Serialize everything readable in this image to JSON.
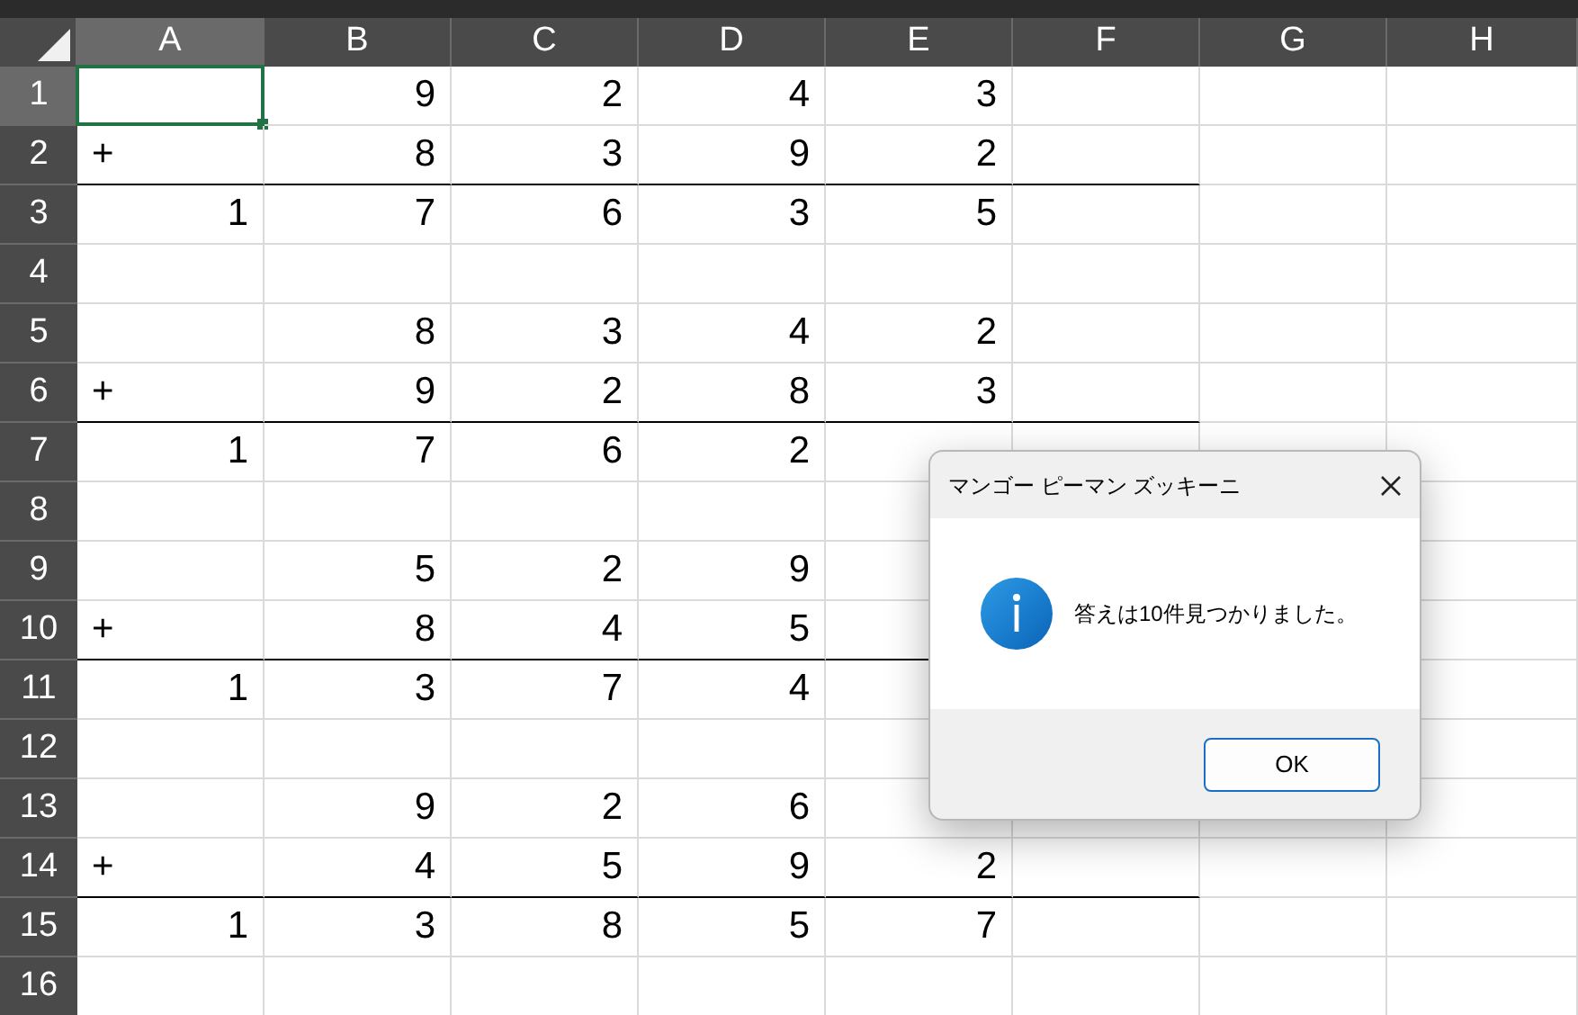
{
  "sheet": {
    "columns": [
      {
        "label": "A",
        "selected": true
      },
      {
        "label": "B",
        "selected": false
      },
      {
        "label": "C",
        "selected": false
      },
      {
        "label": "D",
        "selected": false
      },
      {
        "label": "E",
        "selected": false
      },
      {
        "label": "F",
        "selected": false
      },
      {
        "label": "G",
        "selected": false
      },
      {
        "label": "H",
        "selected": false
      }
    ],
    "rows": [
      {
        "header": "1",
        "selected": true,
        "underlined": false,
        "cells": [
          null,
          "9",
          "2",
          "4",
          "3"
        ]
      },
      {
        "header": "2",
        "selected": false,
        "underlined": true,
        "operator": "+",
        "cells": [
          null,
          "8",
          "3",
          "9",
          "2"
        ]
      },
      {
        "header": "3",
        "selected": false,
        "underlined": false,
        "cells": [
          "1",
          "7",
          "6",
          "3",
          "5"
        ]
      },
      {
        "header": "4",
        "selected": false,
        "underlined": false,
        "cells": []
      },
      {
        "header": "5",
        "selected": false,
        "underlined": false,
        "cells": [
          null,
          "8",
          "3",
          "4",
          "2"
        ]
      },
      {
        "header": "6",
        "selected": false,
        "underlined": true,
        "operator": "+",
        "cells": [
          null,
          "9",
          "2",
          "8",
          "3"
        ]
      },
      {
        "header": "7",
        "selected": false,
        "underlined": false,
        "cells": [
          "1",
          "7",
          "6",
          "2"
        ]
      },
      {
        "header": "8",
        "selected": false,
        "underlined": false,
        "cells": []
      },
      {
        "header": "9",
        "selected": false,
        "underlined": false,
        "cells": [
          null,
          "5",
          "2",
          "9"
        ]
      },
      {
        "header": "10",
        "selected": false,
        "underlined": true,
        "operator": "+",
        "cells": [
          null,
          "8",
          "4",
          "5"
        ]
      },
      {
        "header": "11",
        "selected": false,
        "underlined": false,
        "cells": [
          "1",
          "3",
          "7",
          "4"
        ]
      },
      {
        "header": "12",
        "selected": false,
        "underlined": false,
        "cells": []
      },
      {
        "header": "13",
        "selected": false,
        "underlined": false,
        "cells": [
          null,
          "9",
          "2",
          "6"
        ]
      },
      {
        "header": "14",
        "selected": false,
        "underlined": true,
        "operator": "+",
        "cells": [
          null,
          "4",
          "5",
          "9",
          "2"
        ]
      },
      {
        "header": "15",
        "selected": false,
        "underlined": false,
        "cells": [
          "1",
          "3",
          "8",
          "5",
          "7"
        ]
      },
      {
        "header": "16",
        "selected": false,
        "underlined": false,
        "cells": []
      }
    ]
  },
  "dialog": {
    "title": "マンゴー ピーマン ズッキーニ",
    "message": "答えは10件見つかりました。",
    "buttons": [
      "OK"
    ]
  }
}
